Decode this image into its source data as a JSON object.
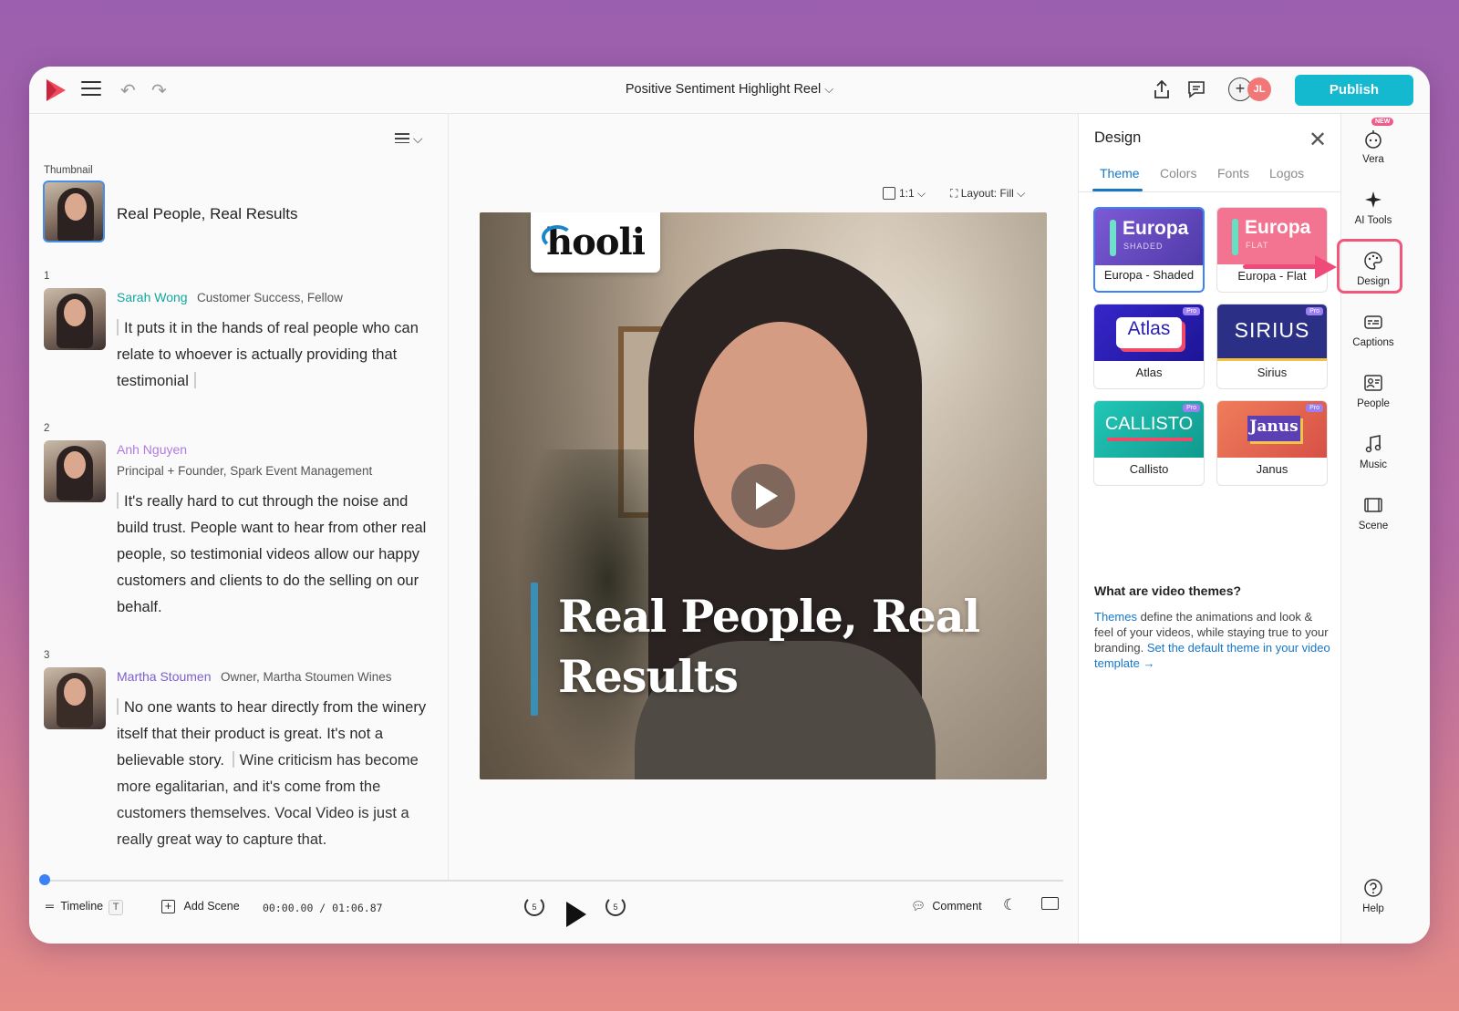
{
  "header": {
    "title": "Positive Sentiment Highlight Reel",
    "avatar_initials": "JL",
    "add_collab": "+",
    "publish_label": "Publish"
  },
  "transcript": {
    "thumbnail_label": "Thumbnail",
    "title": "Real People, Real Results",
    "items": [
      {
        "index": "1",
        "speaker": "Sarah Wong",
        "role": "Customer Success, Fellow",
        "speaker_color": "#11a6a0",
        "quote": "It puts it in the hands of real people who can relate to whoever is actually providing that testimonial"
      },
      {
        "index": "2",
        "speaker": "Anh Nguyen",
        "role": "Principal + Founder, Spark Event Management",
        "speaker_color": "#b07be0",
        "quote": "It's really hard to cut through the noise and build trust. People want to hear from other real people, so testimonial videos allow our happy customers and clients to do the selling on our behalf."
      },
      {
        "index": "3",
        "speaker": "Martha Stoumen",
        "role": "Owner, Martha Stoumen Wines",
        "speaker_color": "#7b5fd0",
        "quote_a": "No one wants to hear directly from the winery itself that their product is great. It's not a believable story.",
        "quote_b": "Wine criticism has become more egalitarian, and it's come from the customers themselves. Vocal Video is just a really great way to capture that."
      }
    ]
  },
  "preview": {
    "aspect_label": "1:1",
    "layout_label": "Layout: Fill",
    "logo_text": "hooli",
    "video_title": "Real People, Real Results"
  },
  "bottombar": {
    "timeline_label": "Timeline",
    "timeline_key": "T",
    "add_scene_label": "Add Scene",
    "timecode": "00:00.00 / 01:06.87",
    "rewind_seconds": "5",
    "forward_seconds": "5",
    "comment_label": "Comment"
  },
  "design": {
    "title": "Design",
    "tabs": [
      "Theme",
      "Colors",
      "Fonts",
      "Logos"
    ],
    "themes": [
      {
        "name": "Europa - Shaded",
        "preview_title": "Europa",
        "preview_sub": "SHADED",
        "bg": "#6a4fc8"
      },
      {
        "name": "Europa - Flat",
        "preview_title": "Europa",
        "preview_sub": "FLAT",
        "bg": "#f06e8a"
      },
      {
        "name": "Atlas",
        "preview_title": "Atlas",
        "bg": "#2a1fb3",
        "pro": "Pro"
      },
      {
        "name": "Sirius",
        "preview_title": "SIRIUS",
        "bg": "#2b2f86",
        "pro": "Pro"
      },
      {
        "name": "Callisto",
        "preview_title": "CALLISTO",
        "bg": "#1ab6a8",
        "pro": "Pro"
      },
      {
        "name": "Janus",
        "preview_title": "Janus",
        "bg": "#e8674e",
        "pro": "Pro"
      }
    ],
    "help_title": "What are video themes?",
    "help_link_1": "Themes",
    "help_text": " define the animations and look & feel of your videos, while staying true to your branding. ",
    "help_link_2": "Set the default theme in your video template →"
  },
  "rail": {
    "items": [
      "Vera",
      "AI Tools",
      "Design",
      "Captions",
      "People",
      "Music",
      "Scene"
    ],
    "help": "Help",
    "new_badge": "NEW"
  },
  "colors": {
    "accent": "#14b8cf",
    "active_tab": "#1677c9",
    "highlight": "#ef4a7a"
  }
}
